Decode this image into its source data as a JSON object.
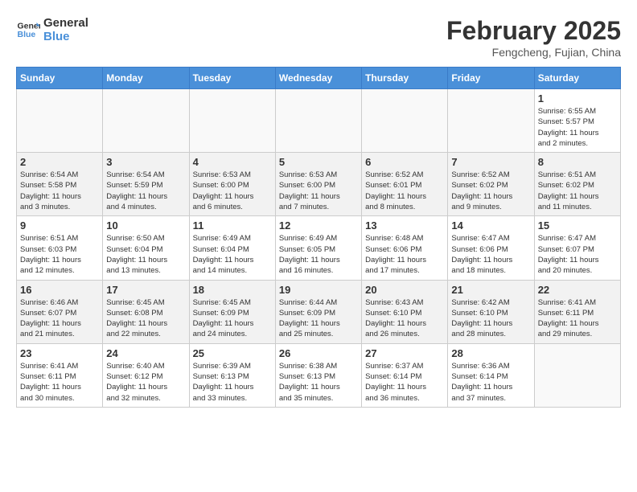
{
  "header": {
    "logo_general": "General",
    "logo_blue": "Blue",
    "month_year": "February 2025",
    "location": "Fengcheng, Fujian, China"
  },
  "weekdays": [
    "Sunday",
    "Monday",
    "Tuesday",
    "Wednesday",
    "Thursday",
    "Friday",
    "Saturday"
  ],
  "weeks": [
    [
      {
        "day": "",
        "info": ""
      },
      {
        "day": "",
        "info": ""
      },
      {
        "day": "",
        "info": ""
      },
      {
        "day": "",
        "info": ""
      },
      {
        "day": "",
        "info": ""
      },
      {
        "day": "",
        "info": ""
      },
      {
        "day": "1",
        "info": "Sunrise: 6:55 AM\nSunset: 5:57 PM\nDaylight: 11 hours\nand 2 minutes."
      }
    ],
    [
      {
        "day": "2",
        "info": "Sunrise: 6:54 AM\nSunset: 5:58 PM\nDaylight: 11 hours\nand 3 minutes."
      },
      {
        "day": "3",
        "info": "Sunrise: 6:54 AM\nSunset: 5:59 PM\nDaylight: 11 hours\nand 4 minutes."
      },
      {
        "day": "4",
        "info": "Sunrise: 6:53 AM\nSunset: 6:00 PM\nDaylight: 11 hours\nand 6 minutes."
      },
      {
        "day": "5",
        "info": "Sunrise: 6:53 AM\nSunset: 6:00 PM\nDaylight: 11 hours\nand 7 minutes."
      },
      {
        "day": "6",
        "info": "Sunrise: 6:52 AM\nSunset: 6:01 PM\nDaylight: 11 hours\nand 8 minutes."
      },
      {
        "day": "7",
        "info": "Sunrise: 6:52 AM\nSunset: 6:02 PM\nDaylight: 11 hours\nand 9 minutes."
      },
      {
        "day": "8",
        "info": "Sunrise: 6:51 AM\nSunset: 6:02 PM\nDaylight: 11 hours\nand 11 minutes."
      }
    ],
    [
      {
        "day": "9",
        "info": "Sunrise: 6:51 AM\nSunset: 6:03 PM\nDaylight: 11 hours\nand 12 minutes."
      },
      {
        "day": "10",
        "info": "Sunrise: 6:50 AM\nSunset: 6:04 PM\nDaylight: 11 hours\nand 13 minutes."
      },
      {
        "day": "11",
        "info": "Sunrise: 6:49 AM\nSunset: 6:04 PM\nDaylight: 11 hours\nand 14 minutes."
      },
      {
        "day": "12",
        "info": "Sunrise: 6:49 AM\nSunset: 6:05 PM\nDaylight: 11 hours\nand 16 minutes."
      },
      {
        "day": "13",
        "info": "Sunrise: 6:48 AM\nSunset: 6:06 PM\nDaylight: 11 hours\nand 17 minutes."
      },
      {
        "day": "14",
        "info": "Sunrise: 6:47 AM\nSunset: 6:06 PM\nDaylight: 11 hours\nand 18 minutes."
      },
      {
        "day": "15",
        "info": "Sunrise: 6:47 AM\nSunset: 6:07 PM\nDaylight: 11 hours\nand 20 minutes."
      }
    ],
    [
      {
        "day": "16",
        "info": "Sunrise: 6:46 AM\nSunset: 6:07 PM\nDaylight: 11 hours\nand 21 minutes."
      },
      {
        "day": "17",
        "info": "Sunrise: 6:45 AM\nSunset: 6:08 PM\nDaylight: 11 hours\nand 22 minutes."
      },
      {
        "day": "18",
        "info": "Sunrise: 6:45 AM\nSunset: 6:09 PM\nDaylight: 11 hours\nand 24 minutes."
      },
      {
        "day": "19",
        "info": "Sunrise: 6:44 AM\nSunset: 6:09 PM\nDaylight: 11 hours\nand 25 minutes."
      },
      {
        "day": "20",
        "info": "Sunrise: 6:43 AM\nSunset: 6:10 PM\nDaylight: 11 hours\nand 26 minutes."
      },
      {
        "day": "21",
        "info": "Sunrise: 6:42 AM\nSunset: 6:10 PM\nDaylight: 11 hours\nand 28 minutes."
      },
      {
        "day": "22",
        "info": "Sunrise: 6:41 AM\nSunset: 6:11 PM\nDaylight: 11 hours\nand 29 minutes."
      }
    ],
    [
      {
        "day": "23",
        "info": "Sunrise: 6:41 AM\nSunset: 6:11 PM\nDaylight: 11 hours\nand 30 minutes."
      },
      {
        "day": "24",
        "info": "Sunrise: 6:40 AM\nSunset: 6:12 PM\nDaylight: 11 hours\nand 32 minutes."
      },
      {
        "day": "25",
        "info": "Sunrise: 6:39 AM\nSunset: 6:13 PM\nDaylight: 11 hours\nand 33 minutes."
      },
      {
        "day": "26",
        "info": "Sunrise: 6:38 AM\nSunset: 6:13 PM\nDaylight: 11 hours\nand 35 minutes."
      },
      {
        "day": "27",
        "info": "Sunrise: 6:37 AM\nSunset: 6:14 PM\nDaylight: 11 hours\nand 36 minutes."
      },
      {
        "day": "28",
        "info": "Sunrise: 6:36 AM\nSunset: 6:14 PM\nDaylight: 11 hours\nand 37 minutes."
      },
      {
        "day": "",
        "info": ""
      }
    ]
  ]
}
